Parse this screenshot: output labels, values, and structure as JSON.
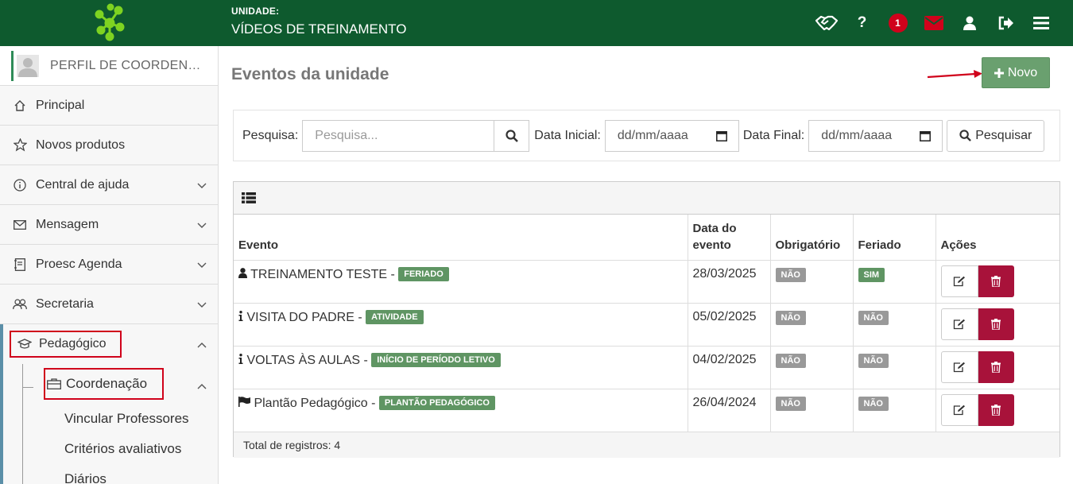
{
  "header": {
    "unit_label": "UNIDADE:",
    "unit_name": "VÍDEOS DE TREINAMENTO",
    "notification_count": "1",
    "icons": [
      "handshake-icon",
      "help-icon",
      "notification-badge",
      "mail-icon",
      "user-icon",
      "logout-icon",
      "menu-icon"
    ]
  },
  "sidebar": {
    "profile": "PERFIL DE COORDEN…",
    "items": [
      {
        "label": "Principal",
        "icon": "home-icon"
      },
      {
        "label": "Novos produtos",
        "icon": "star-icon"
      },
      {
        "label": "Central de ajuda",
        "icon": "info-icon"
      },
      {
        "label": "Mensagem",
        "icon": "envelope-icon"
      },
      {
        "label": "Proesc Agenda",
        "icon": "agenda-icon"
      },
      {
        "label": "Secretaria",
        "icon": "people-icon"
      },
      {
        "label": "Pedagógico",
        "icon": "graduation-cap-icon"
      }
    ],
    "sub": {
      "label": "Coordenação",
      "children": [
        "Vincular Professores",
        "Critérios avaliativos",
        "Diários"
      ]
    }
  },
  "main": {
    "title": "Eventos da unidade",
    "new_button": "Novo",
    "filter": {
      "search_label": "Pesquisa:",
      "search_placeholder": "Pesquisa...",
      "start_label": "Data Inicial:",
      "start_value": "dd/mm/aaaa",
      "end_label": "Data Final:",
      "end_value": "dd/mm/aaaa",
      "search_button": "Pesquisar"
    },
    "table": {
      "headers": {
        "evento": "Evento",
        "data_l1": "Data do",
        "data_l2": "evento",
        "obrigatorio": "Obrigatório",
        "feriado": "Feriado",
        "acoes": "Ações"
      },
      "rows": [
        {
          "icon": "user-icon",
          "name": "TREINAMENTO TESTE - ",
          "tag": "FERIADO",
          "date": "28/03/2025",
          "obrigatorio": "NÃO",
          "feriado": "SIM",
          "feriado_color": "#5f9563"
        },
        {
          "icon": "info-icon",
          "name": "VISITA DO PADRE - ",
          "tag": "ATIVIDADE",
          "date": "05/02/2025",
          "obrigatorio": "NÃO",
          "feriado": "NÃO",
          "feriado_color": "#999999"
        },
        {
          "icon": "info-icon",
          "name": "VOLTAS ÀS AULAS - ",
          "tag": "INÍCIO DE PERÍODO LETIVO",
          "date": "04/02/2025",
          "obrigatorio": "NÃO",
          "feriado": "NÃO",
          "feriado_color": "#999999"
        },
        {
          "icon": "flag-icon",
          "name": "Plantão Pedagógico - ",
          "tag": "PLANTÃO PEDAGÓGICO",
          "date": "26/04/2024",
          "obrigatorio": "NÃO",
          "feriado": "NÃO",
          "feriado_color": "#999999"
        }
      ],
      "footer": "Total de registros: 4"
    }
  },
  "colors": {
    "topbar": "#0e5a2e",
    "accent_green": "#6aa06f",
    "danger": "#a8123a",
    "highlight_box": "#d0021b"
  }
}
